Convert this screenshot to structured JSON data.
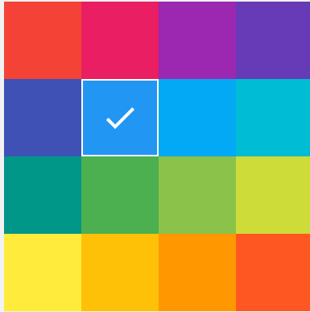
{
  "palette": {
    "selected_index": 5,
    "selected_icon": "check-icon",
    "swatches": [
      {
        "name": "swatch-red",
        "color": "#F44336"
      },
      {
        "name": "swatch-pink",
        "color": "#E91E63"
      },
      {
        "name": "swatch-purple",
        "color": "#9C27B0"
      },
      {
        "name": "swatch-deep-purple",
        "color": "#673AB7"
      },
      {
        "name": "swatch-indigo",
        "color": "#3F51B5"
      },
      {
        "name": "swatch-blue",
        "color": "#2196F3"
      },
      {
        "name": "swatch-light-blue",
        "color": "#03A9F4"
      },
      {
        "name": "swatch-cyan",
        "color": "#00BCD4"
      },
      {
        "name": "swatch-teal",
        "color": "#009688"
      },
      {
        "name": "swatch-green",
        "color": "#4CAF50"
      },
      {
        "name": "swatch-light-green",
        "color": "#8BC34A"
      },
      {
        "name": "swatch-lime",
        "color": "#CDDC39"
      },
      {
        "name": "swatch-yellow",
        "color": "#FFEB3B"
      },
      {
        "name": "swatch-amber",
        "color": "#FFC107"
      },
      {
        "name": "swatch-orange",
        "color": "#FF9800"
      },
      {
        "name": "swatch-deep-orange",
        "color": "#FF5722"
      }
    ]
  }
}
